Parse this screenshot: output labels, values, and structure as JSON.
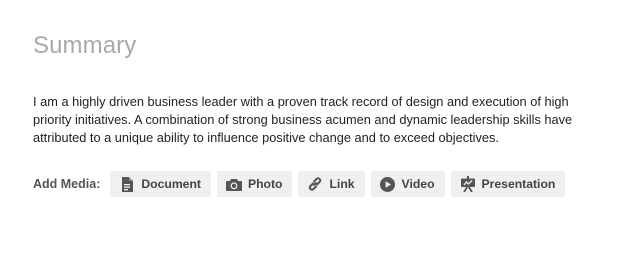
{
  "summary": {
    "title": "Summary",
    "text": "I am a highly driven business leader with a proven track record of design and execution of high priority initiatives. A combination of strong business acumen and dynamic leadership skills have attributed to a unique ability to influence positive change and to exceed objectives."
  },
  "media": {
    "label": "Add Media:",
    "buttons": [
      {
        "label": "Document",
        "icon": "document-icon"
      },
      {
        "label": "Photo",
        "icon": "camera-icon"
      },
      {
        "label": "Link",
        "icon": "link-icon"
      },
      {
        "label": "Video",
        "icon": "play-icon"
      },
      {
        "label": "Presentation",
        "icon": "presentation-icon"
      }
    ]
  },
  "colors": {
    "title": "#a9a9a9",
    "body_text": "#222222",
    "button_bg": "#f0f0f0",
    "button_text": "#444444",
    "icon": "#555555"
  }
}
